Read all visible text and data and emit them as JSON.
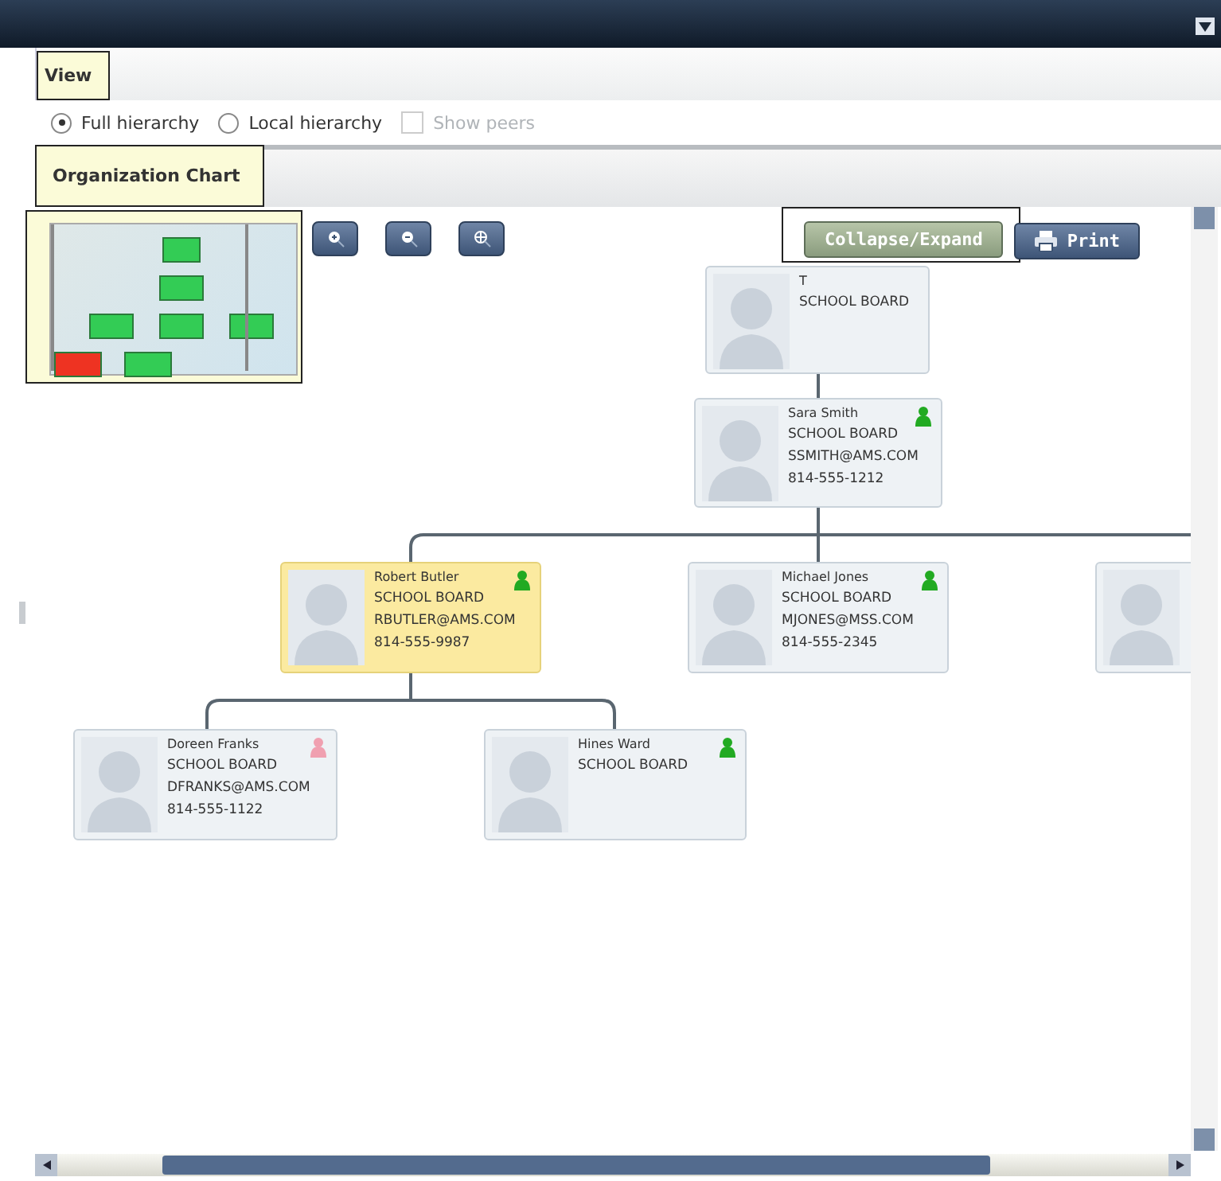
{
  "view": {
    "title": "View",
    "options": [
      {
        "label": "Full hierarchy",
        "selected": true
      },
      {
        "label": "Local hierarchy",
        "selected": false
      }
    ],
    "show_peers": {
      "label": "Show peers",
      "checked": false,
      "disabled": true
    }
  },
  "org_chart": {
    "title": "Organization Chart",
    "minimap": {
      "boxes": [
        {
          "color": "#33cc55"
        },
        {
          "color": "#33cc55"
        },
        {
          "color": "#33cc55"
        },
        {
          "color": "#33cc55"
        },
        {
          "color": "#33cc55"
        },
        {
          "color": "#ee3322"
        },
        {
          "color": "#33cc55"
        }
      ]
    },
    "buttons": {
      "collapse_expand": "Collapse/Expand",
      "print": "Print"
    },
    "root": {
      "kind": "person",
      "name": "T",
      "department": "SCHOOL BOARD",
      "selected": false,
      "children": [
        {
          "kind": "person",
          "name": "Sara Smith",
          "department": "SCHOOL BOARD",
          "email": "SSMITH@AMS.COM",
          "phone": "814-555-1212",
          "color": "#22aa22",
          "selected": false,
          "children": [
            {
              "kind": "person",
              "name": "Robert Butler",
              "department": "SCHOOL BOARD",
              "email": "RBUTLER@AMS.COM",
              "phone": "814-555-9987",
              "color": "#22aa22",
              "selected": true,
              "children": [
                {
                  "kind": "person",
                  "name": "Doreen Franks",
                  "department": "SCHOOL BOARD",
                  "email": "DFRANKS@AMS.COM",
                  "phone": "814-555-1122",
                  "color": "#f0a0b0",
                  "selected": false
                },
                {
                  "kind": "person",
                  "name": "Hines Ward",
                  "department": "SCHOOL BOARD",
                  "color": "#22aa22",
                  "selected": false
                }
              ]
            },
            {
              "kind": "person",
              "name": "Michael Jones",
              "department": "SCHOOL BOARD",
              "email": "MJONES@MSS.COM",
              "phone": "814-555-2345",
              "color": "#22aa22",
              "selected": false
            },
            {
              "kind": "person",
              "selected": false
            }
          ]
        }
      ]
    }
  }
}
